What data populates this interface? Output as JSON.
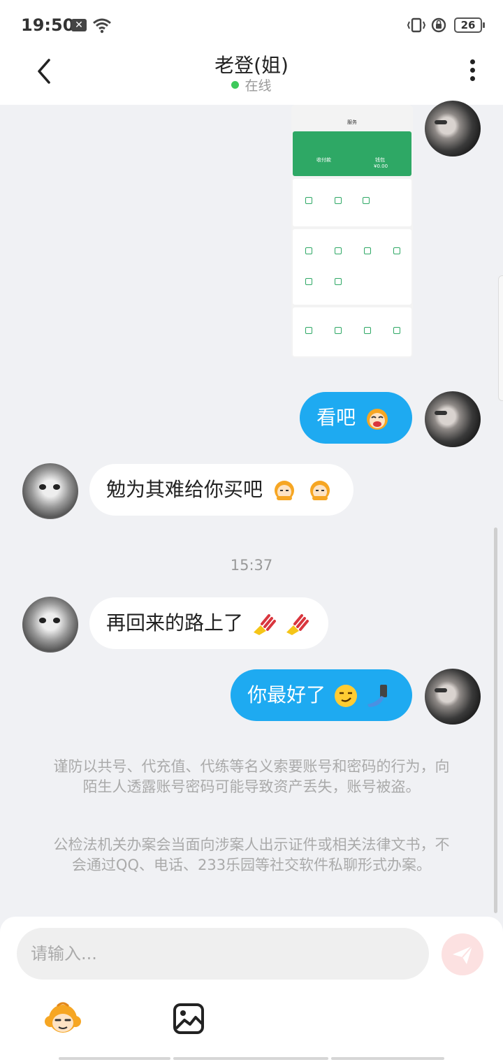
{
  "status_bar": {
    "time": "19:50",
    "battery": "26"
  },
  "header": {
    "title": "老登(姐)",
    "presence": "在线",
    "presence_color": "#3ec95b"
  },
  "shared_image": {
    "page_title": "服务",
    "tile_left": "收付款",
    "tile_right": "钱包",
    "balance": "¥0.00"
  },
  "messages": {
    "me_1": "看吧",
    "friend_1": "勉为其难给你买吧",
    "timestamp": "15:37",
    "friend_2": "再回来的路上了",
    "me_2": "你最好了"
  },
  "notices": {
    "warning_1": "谨防以共号、代充值、代练等名义索要账号和密码的行为，向陌生人透露账号密码可能导致资产丢失，账号被盗。",
    "warning_2": "公检法机关办案会当面向涉案人出示证件或相关法律文书，不会通过QQ、电话、233乐园等社交软件私聊形式办案。"
  },
  "composer": {
    "placeholder": "请输入..."
  },
  "colors": {
    "my_bubble": "#1eaaf1",
    "friend_bubble": "#ffffff",
    "background": "#f0f1f4",
    "send_button": "#fce1e1",
    "wallet_green": "#2ea865"
  },
  "icons": [
    "back-arrow-icon",
    "more-vertical-icon",
    "wifi-icon",
    "vibrate-icon",
    "rotation-lock-icon",
    "send-icon",
    "emoji-icon",
    "image-icon"
  ]
}
